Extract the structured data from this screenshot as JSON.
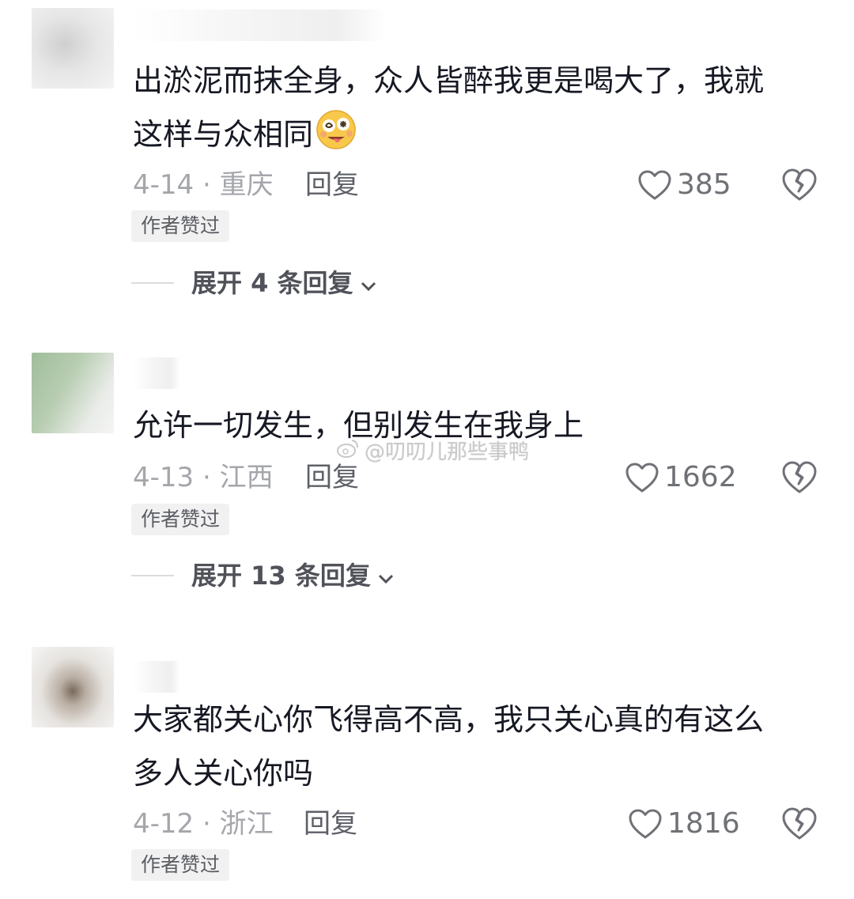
{
  "comments": [
    {
      "text_line1": "出淤泥而抹全身，众人皆醉我更是喝大了，我就",
      "text_line2": "这样与众相同",
      "date_location": "4-14 · 重庆",
      "reply_label": "回复",
      "likes": "385",
      "author_badge": "作者赞过",
      "expand_label": "展开 4 条回复"
    },
    {
      "text_line1": "允许一切发生，但别发生在我身上",
      "date_location": "4-13 · 江西",
      "reply_label": "回复",
      "likes": "1662",
      "author_badge": "作者赞过",
      "expand_label": "展开 13 条回复"
    },
    {
      "text_line1": "大家都关心你飞得高不高，我只关心真的有这么",
      "text_line2": "多人关心你吗",
      "date_location": "4-12 · 浙江",
      "reply_label": "回复",
      "likes": "1816",
      "author_badge": "作者赞过"
    }
  ],
  "watermark": "@叨叨儿那些事鸭",
  "icons": {
    "like": "heart-outline-icon",
    "dislike": "broken-heart-icon",
    "expand": "chevron-down-icon",
    "emoji": "dizzy-tongue-emoji-icon",
    "watermark": "weibo-logo-icon"
  },
  "colors": {
    "text": "#161823",
    "meta": "#a4a6ab",
    "badge_bg": "#f1f1f2"
  }
}
